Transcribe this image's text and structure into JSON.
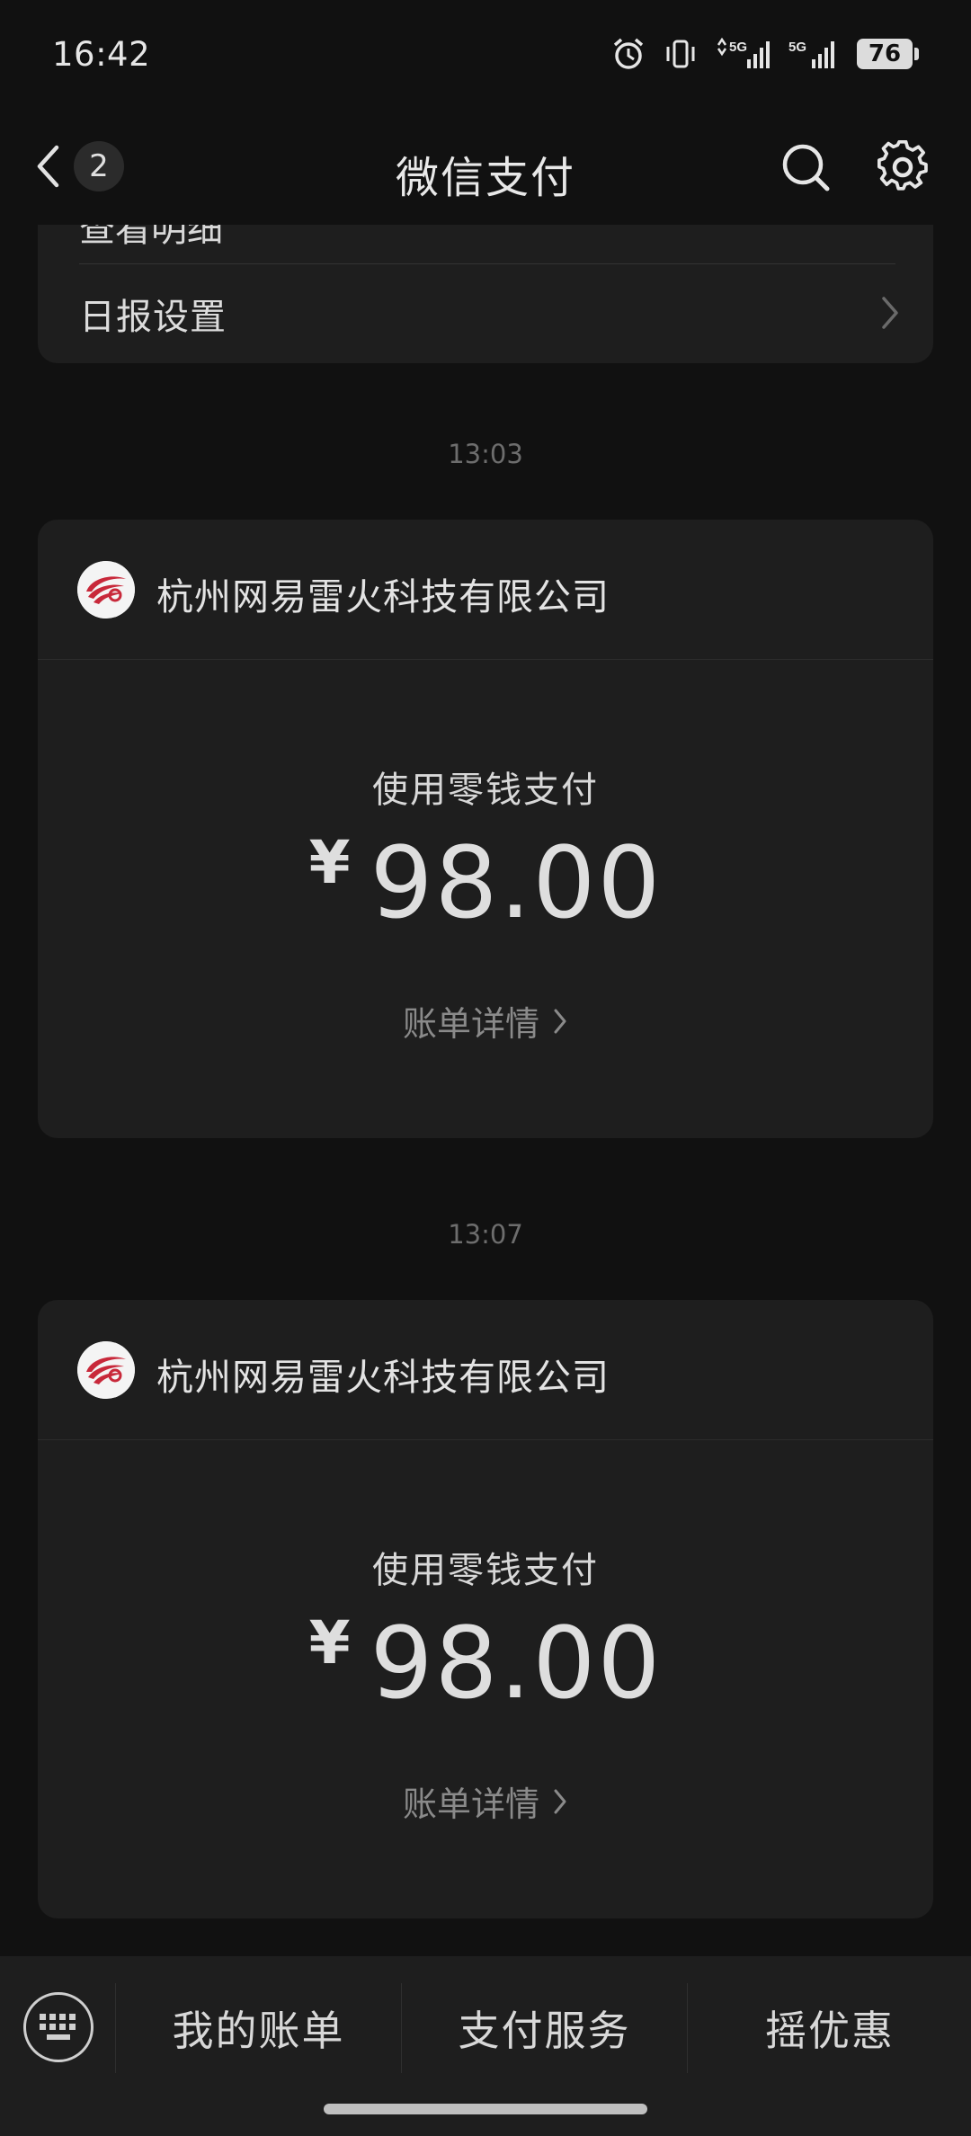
{
  "status_bar": {
    "time": "16:42",
    "battery": "76",
    "network_1": "5G",
    "network_2": "5G"
  },
  "nav": {
    "back_badge": "2",
    "title": "微信支付"
  },
  "top_card": {
    "partial_row_label": "查看明细",
    "daily_report_label": "日报设置"
  },
  "messages": [
    {
      "time": "13:03",
      "merchant": "杭州网易雷火科技有限公司",
      "method": "使用零钱支付",
      "currency": "¥",
      "amount": "98.00",
      "detail_link": "账单详情"
    },
    {
      "time": "13:07",
      "merchant": "杭州网易雷火科技有限公司",
      "method": "使用零钱支付",
      "currency": "¥",
      "amount": "98.00",
      "detail_link": "账单详情"
    }
  ],
  "bottom_menu": {
    "item_1": "我的账单",
    "item_2": "支付服务",
    "item_3": "摇优惠"
  },
  "colors": {
    "background": "#111111",
    "card": "#1e1e1e",
    "logo_red": "#c8283a"
  }
}
